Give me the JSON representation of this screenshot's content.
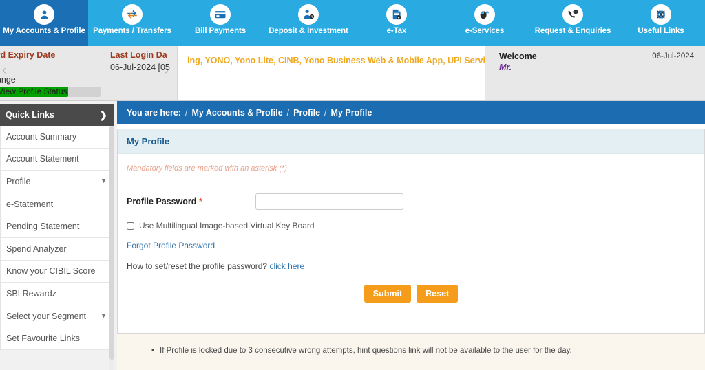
{
  "nav": {
    "tabs": [
      {
        "label": "My Accounts & Profile",
        "icon": "user-icon",
        "active": true
      },
      {
        "label": "Payments / Transfers",
        "icon": "transfer-arrows-icon",
        "active": false
      },
      {
        "label": "Bill Payments",
        "icon": "card-icon",
        "active": false
      },
      {
        "label": "Deposit & Investment",
        "icon": "deposit-money-icon",
        "active": false
      },
      {
        "label": "e-Tax",
        "icon": "tax-document-icon",
        "active": false
      },
      {
        "label": "e-Services",
        "icon": "mouse-icon",
        "active": false
      },
      {
        "label": "Request & Enquiries",
        "icon": "phone-icon",
        "active": false
      },
      {
        "label": "Useful Links",
        "icon": "link-globe-icon",
        "active": false
      }
    ]
  },
  "infobar": {
    "password_expiry_title": "ord Expiry Date",
    "password_expiry_sub": "hange",
    "profile_status_label": "View Profile Status",
    "progress_percent": 70,
    "last_login_title": "Last Login Da",
    "last_login_date": "06-Jul-2024 [05",
    "prev_arrow": "‹",
    "next_arrow": "›",
    "ticker_text": "ing, YONO, Yono Lite, CINB, Yono Business Web & Mobile App, UPI Servi",
    "welcome_title": "Welcome",
    "welcome_name": "Mr.",
    "date": "06-Jul-2024"
  },
  "sidebar": {
    "header": "Quick Links",
    "header_chevron": "❯",
    "items": [
      {
        "label": "Account Summary",
        "caret": ""
      },
      {
        "label": "Account Statement",
        "caret": ""
      },
      {
        "label": "Profile",
        "caret": "▼"
      },
      {
        "label": "e-Statement",
        "caret": ""
      },
      {
        "label": "Pending Statement",
        "caret": ""
      },
      {
        "label": "Spend Analyzer",
        "caret": ""
      },
      {
        "label": "Know your CIBIL Score",
        "caret": ""
      },
      {
        "label": "SBI Rewardz",
        "caret": ""
      },
      {
        "label": "Select your Segment",
        "caret": "▼"
      },
      {
        "label": "Set Favourite Links",
        "caret": ""
      }
    ]
  },
  "breadcrumb": {
    "prefix": "You are here:",
    "sep": "/",
    "items": [
      "My Accounts & Profile",
      "Profile",
      "My Profile"
    ]
  },
  "panel": {
    "title": "My Profile",
    "mandatory_note": "Mandatory fields are marked with an asterisk (*)",
    "password_label": "Profile Password",
    "password_asterisk": "*",
    "password_value": "",
    "password_placeholder": "",
    "checkbox_label": "Use Multilingual Image-based Virtual Key Board",
    "checkbox_checked": false,
    "forgot_link": "Forgot Profile Password",
    "howto_text": "How to set/reset the profile password?",
    "howto_link": "click here",
    "submit_label": "Submit",
    "reset_label": "Reset"
  },
  "footer": {
    "note": "If Profile is locked due to 3 consecutive wrong attempts, hint questions link will not be available to the user for the day."
  },
  "colors": {
    "nav_bg": "#29abe2",
    "nav_active": "#1a6fb5",
    "breadcrumb": "#1b6cb0",
    "panel_head": "#e3eff2",
    "button": "#f59c1b",
    "progress": "#00a000",
    "ticker": "#f0a81e",
    "footer_bg": "#faf6ee"
  }
}
